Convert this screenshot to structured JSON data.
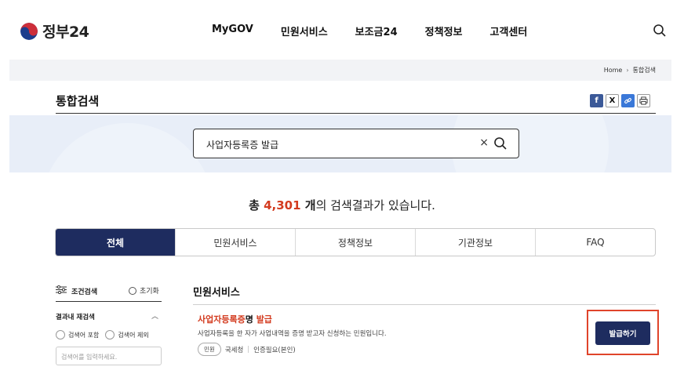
{
  "header": {
    "logo_text": "정부24",
    "nav": [
      "MyGOV",
      "민원서비스",
      "보조금24",
      "정책정보",
      "고객센터"
    ],
    "search_icon": "search-icon"
  },
  "breadcrumb": {
    "home": "Home",
    "separator": "›",
    "current": "통합검색"
  },
  "page_title": "통합검색",
  "share": {
    "facebook": "f",
    "x": "X",
    "link": "🔗",
    "print": "🖶"
  },
  "search": {
    "value": "사업자등록증 발급",
    "clear": "×"
  },
  "result_summary": {
    "prefix": "총 ",
    "count": "4,301",
    "unit": " 개",
    "suffix": "의 검색결과가 있습니다."
  },
  "tabs": [
    {
      "label": "전체",
      "active": true
    },
    {
      "label": "민원서비스",
      "active": false
    },
    {
      "label": "정책정보",
      "active": false
    },
    {
      "label": "기관정보",
      "active": false
    },
    {
      "label": "FAQ",
      "active": false
    }
  ],
  "filter": {
    "title": "조건검색",
    "reset": "초기화",
    "refine_title": "결과내 재검색",
    "option_include": "검색어 포함",
    "option_exclude": "검색어 제외",
    "input_placeholder": "검색어를 입력하세요."
  },
  "results": {
    "section_title": "민원서비스",
    "item": {
      "title_highlight": "사업자등록증",
      "title_plain": "명",
      "title_tail": " 발급",
      "description": "사업자등록을 한 자가 사업내역을 증명 받고자 신청하는 민원입니다.",
      "tag": "민원",
      "agency": "국세청",
      "separator": "|",
      "requirement": "인증필요(본인)",
      "action": "발급하기"
    }
  },
  "colors": {
    "accent_navy": "#1e2c5f",
    "highlight_red": "#d33b1f",
    "frame_red": "#e0442b"
  }
}
